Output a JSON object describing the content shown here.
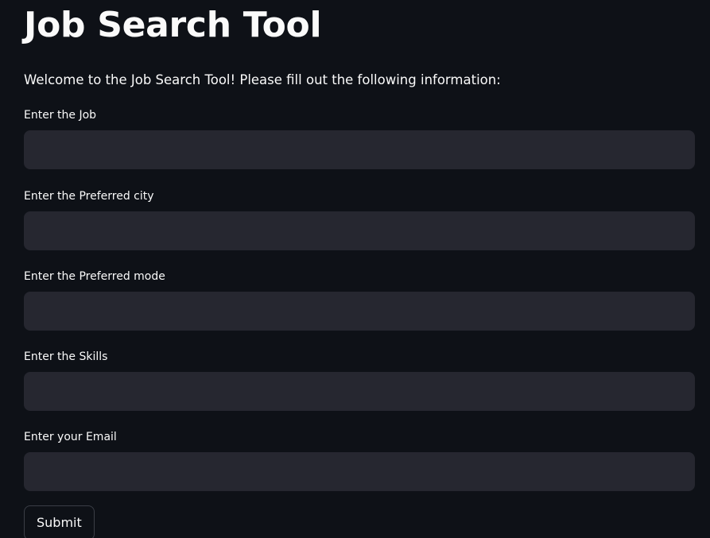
{
  "header": {
    "title": "Job Search Tool"
  },
  "intro": {
    "text": "Welcome to the Job Search Tool! Please fill out the following information:"
  },
  "form": {
    "fields": [
      {
        "label": "Enter the Job",
        "value": ""
      },
      {
        "label": "Enter the Preferred city",
        "value": ""
      },
      {
        "label": "Enter the Preferred mode",
        "value": ""
      },
      {
        "label": "Enter the Skills",
        "value": ""
      },
      {
        "label": "Enter your Email",
        "value": ""
      }
    ],
    "submit_label": "Submit"
  },
  "colors": {
    "background": "#0e1117",
    "input_background": "#262730",
    "text": "#fafafa",
    "button_border": "#3b3e46"
  }
}
